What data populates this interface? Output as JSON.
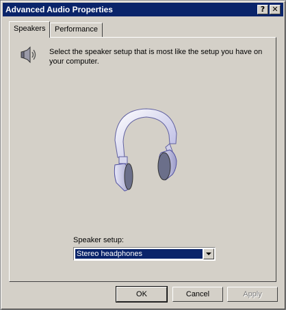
{
  "window": {
    "title": "Advanced Audio Properties",
    "help_glyph": "?",
    "close_glyph": "✕"
  },
  "tabs": [
    {
      "label": "Speakers",
      "active": true
    },
    {
      "label": "Performance",
      "active": false
    }
  ],
  "speakers": {
    "description": "Select the speaker setup that is most like the setup you have on your computer.",
    "icon": "speaker-icon",
    "illustration": "headphones-icon",
    "setup_label": "Speaker setup:",
    "setup_value": "Stereo headphones"
  },
  "buttons": {
    "ok": "OK",
    "cancel": "Cancel",
    "apply": "Apply"
  },
  "colors": {
    "titlebar": "#0a246a",
    "face": "#d4d0c8",
    "selection": "#0a246a"
  }
}
